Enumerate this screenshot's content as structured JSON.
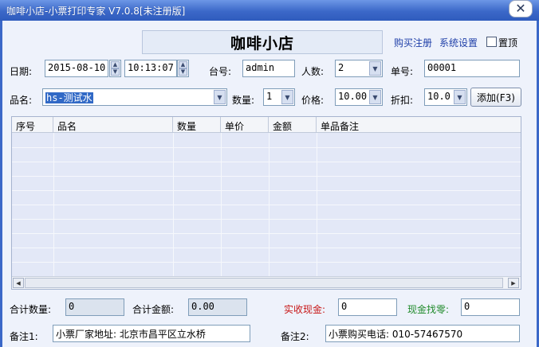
{
  "window": {
    "title": "咖啡小店-小票打印专家 V7.0.8[未注册版]"
  },
  "header": {
    "shop_name": "咖啡小店",
    "buy_link": "购买注册",
    "settings_link": "系统设置",
    "pin_label": "置顶"
  },
  "order": {
    "date_label": "日期:",
    "date_value": "2015-08-10",
    "time_value": "10:13:07",
    "table_label": "台号:",
    "table_value": "admin",
    "people_label": "人数:",
    "people_value": "2",
    "ticket_label": "单号:",
    "ticket_value": "00001"
  },
  "item": {
    "name_label": "品名:",
    "name_value": "hs-测试水",
    "qty_label": "数量:",
    "qty_value": "1",
    "price_label": "价格:",
    "price_value": "10.00",
    "discount_label": "折扣:",
    "discount_value": "10.0",
    "add_button": "添加(F3)"
  },
  "grid": {
    "columns": [
      "序号",
      "品名",
      "数量",
      "单价",
      "金额",
      "单品备注"
    ]
  },
  "totals": {
    "qty_label": "合计数量:",
    "qty_value": "0",
    "amount_label": "合计金额:",
    "amount_value": "0.00",
    "cash_label": "实收现金:",
    "cash_value": "0",
    "change_label": "现金找零:",
    "change_value": "0",
    "cash_color": "#c81818",
    "change_color": "#1f8a2a"
  },
  "notes": {
    "note1_label": "备注1:",
    "note1_value": "小票厂家地址: 北京市昌平区立水桥",
    "note2_label": "备注2:",
    "note2_value": "小票购买电话: 010-57467570"
  }
}
